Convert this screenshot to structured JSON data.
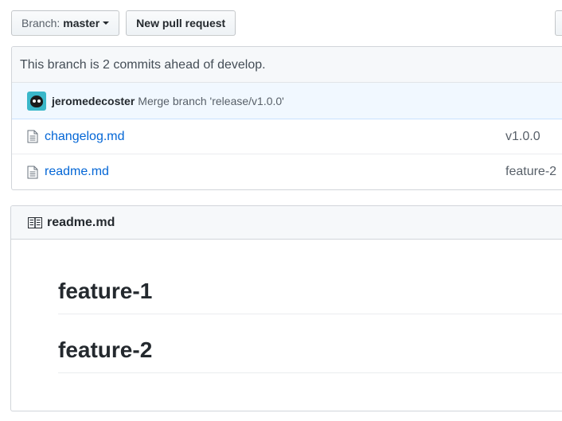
{
  "toolbar": {
    "branch_prefix": "Branch:",
    "branch_name": "master",
    "new_pr_label": "New pull request"
  },
  "branch_status": "This branch is 2 commits ahead of develop.",
  "commit": {
    "author": "jeromedecoster",
    "message": "Merge branch 'release/v1.0.0'"
  },
  "files": [
    {
      "name": "changelog.md",
      "commit": "v1.0.0",
      "icon": "file-icon"
    },
    {
      "name": "readme.md",
      "commit": "feature-2",
      "icon": "file-icon"
    }
  ],
  "readme": {
    "title": "readme.md",
    "icon": "book-icon",
    "headings": [
      "feature-1",
      "feature-2"
    ]
  },
  "colors": {
    "link": "#0366d6",
    "commit_bg": "#f1f8ff",
    "header_bg": "#f6f8fa",
    "avatar_bg": "#3ab7c9"
  }
}
